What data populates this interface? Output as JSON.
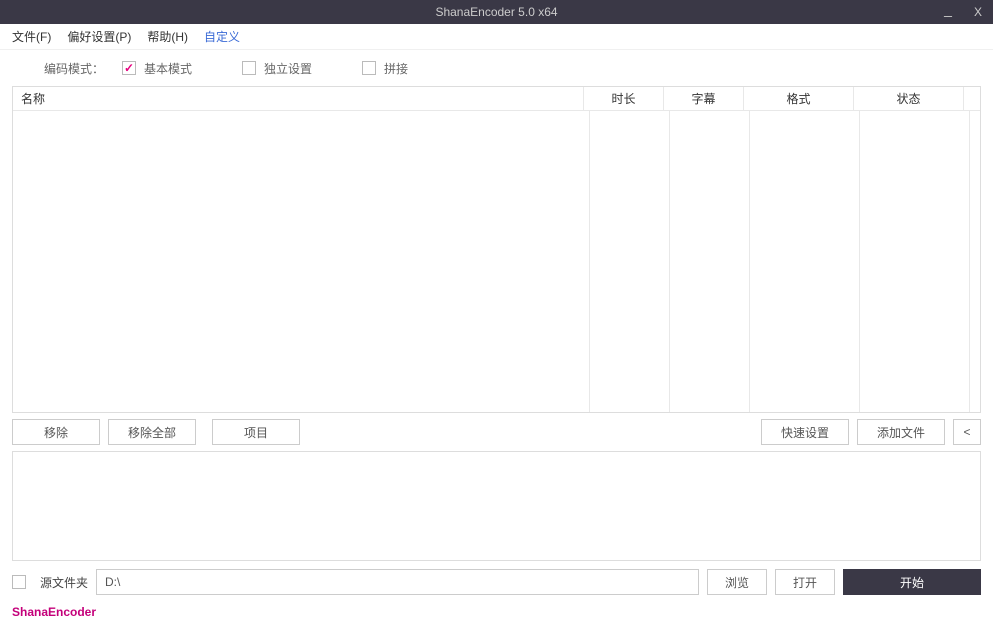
{
  "titlebar": {
    "title": "ShanaEncoder 5.0 x64",
    "minimize": "_",
    "close": "X"
  },
  "menubar": {
    "file": "文件(F)",
    "preferences": "偏好设置(P)",
    "help": "帮助(H)",
    "custom": "自定义"
  },
  "modebar": {
    "label": "编码模式：",
    "basic": "基本模式",
    "independent": "独立设置",
    "concat": "拼接"
  },
  "table": {
    "headers": {
      "name": "名称",
      "duration": "时长",
      "subtitle": "字幕",
      "format": "格式",
      "status": "状态"
    }
  },
  "buttons": {
    "remove": "移除",
    "remove_all": "移除全部",
    "project": "项目",
    "quick_set": "快速设置",
    "add_file": "添加文件",
    "toggle": "<",
    "browse": "浏览",
    "open": "打开",
    "start": "开始"
  },
  "output": {
    "label": "源文件夹",
    "path": "D:\\"
  },
  "footer": {
    "brand": "ShanaEncoder"
  }
}
